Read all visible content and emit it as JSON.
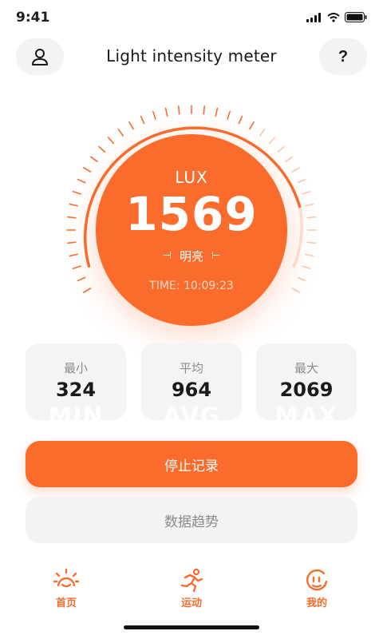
{
  "status_bar": {
    "time": "9:41"
  },
  "header": {
    "title": "Light intensity meter",
    "help_label": "?"
  },
  "meter": {
    "unit": "LUX",
    "value": "1569",
    "level": "明亮",
    "time": "TIME: 10:09:23"
  },
  "stats": [
    {
      "label": "最小",
      "value": "324",
      "watermark": "MIN"
    },
    {
      "label": "平均",
      "value": "964",
      "watermark": "AVG"
    },
    {
      "label": "最大",
      "value": "2069",
      "watermark": "MAX"
    }
  ],
  "buttons": {
    "stop_recording": "停止记录",
    "data_trend": "数据趋势"
  },
  "tabs": [
    {
      "label": "首页",
      "icon": "sun-icon"
    },
    {
      "label": "运动",
      "icon": "running-icon"
    },
    {
      "label": "我的",
      "icon": "smile-icon"
    }
  ],
  "colors": {
    "accent": "#fa6b2c",
    "card_bg": "#f3f4f6"
  }
}
